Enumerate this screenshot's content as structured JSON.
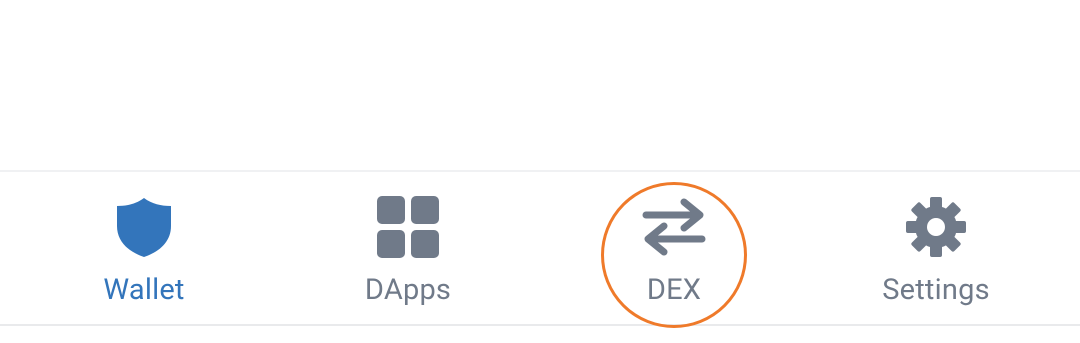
{
  "colors": {
    "active": "#3375bb",
    "inactive": "#707a89",
    "highlight": "#ef7a2a"
  },
  "tabbar": {
    "active_tab": "wallet",
    "highlighted_tab": "dex",
    "tabs": [
      {
        "id": "wallet",
        "label": "Wallet",
        "icon": "shield-icon",
        "active": true
      },
      {
        "id": "dapps",
        "label": "DApps",
        "icon": "grid-icon",
        "active": false
      },
      {
        "id": "dex",
        "label": "DEX",
        "icon": "swap-arrows-icon",
        "active": false
      },
      {
        "id": "settings",
        "label": "Settings",
        "icon": "gear-icon",
        "active": false
      }
    ]
  }
}
